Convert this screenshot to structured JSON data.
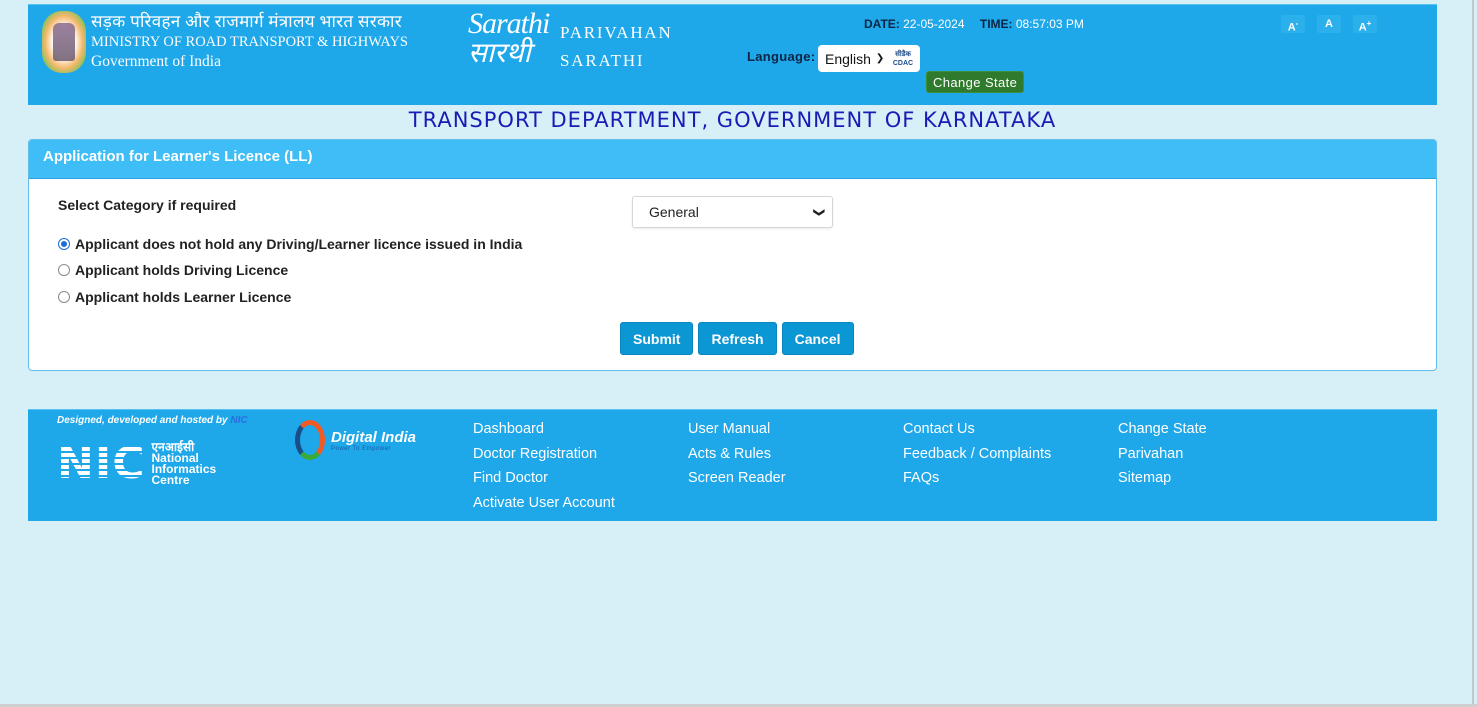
{
  "header": {
    "ministry_hindi": "सड़क परिवहन और राजमार्ग मंत्रालय भारत सरकार",
    "ministry_english": "MINISTRY OF ROAD TRANSPORT & HIGHWAYS",
    "government": "Government of India",
    "sarathi_logo_line1": "Sarathi",
    "sarathi_logo_line2": "सारथी",
    "parivahan_label": "PARIVAHAN",
    "sarathi_label": "SARATHI",
    "date_label": "DATE:",
    "date_value": "22-05-2024",
    "time_label": "TIME:",
    "time_value": "08:57:03 PM",
    "language_label": "Language:",
    "language_selected": "English",
    "cdac_hindi": "सीडैक",
    "cdac_label": "CDAC",
    "change_state_label": "Change State",
    "font_decrease": "A",
    "font_decrease_sup": "-",
    "font_normal": "A",
    "font_increase": "A",
    "font_increase_sup": "+"
  },
  "department_title": "TRANSPORT DEPARTMENT, GOVERNMENT OF KARNATAKA",
  "form": {
    "panel_title": "Application for Learner's Licence (LL)",
    "category_label": "Select Category if required",
    "category_selected": "General",
    "radio_options": [
      {
        "label": "Applicant does not hold any Driving/Learner licence issued in India",
        "checked": true
      },
      {
        "label": "Applicant holds Driving Licence",
        "checked": false
      },
      {
        "label": "Applicant holds Learner Licence",
        "checked": false
      }
    ],
    "submit_label": "Submit",
    "refresh_label": "Refresh",
    "cancel_label": "Cancel"
  },
  "footer": {
    "designed_by": "Designed, developed and hosted by",
    "designed_by_org": "NIC",
    "nic_letters": "NIC",
    "nic_hindi": "एनआईसी",
    "nic_line1": "National",
    "nic_line2": "Informatics",
    "nic_line3": "Centre",
    "digital_india_title": "Digital India",
    "digital_india_sub": "Power To Empower",
    "columns": [
      [
        "Dashboard",
        "Doctor Registration",
        "Find Doctor",
        "Activate User Account"
      ],
      [
        "User Manual",
        "Acts & Rules",
        "Screen Reader"
      ],
      [
        "Contact Us",
        "Feedback / Complaints",
        "FAQs"
      ],
      [
        "Change State",
        "Parivahan",
        "Sitemap"
      ]
    ]
  }
}
